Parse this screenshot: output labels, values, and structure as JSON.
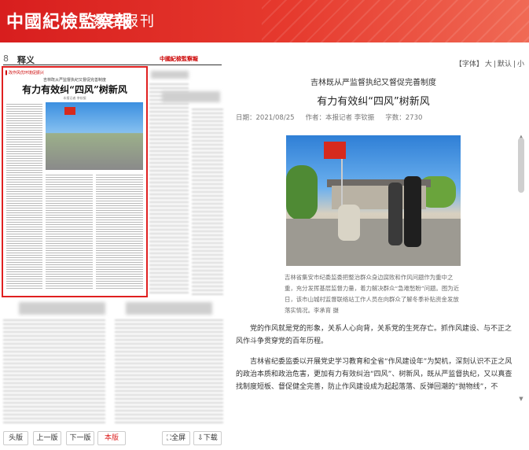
{
  "header": {
    "logo": "中國紀檢監察報",
    "subtitle": "数字报刊"
  },
  "page": {
    "number": "8",
    "column": "释义",
    "masthead": "中國紀檢監察報"
  },
  "thumb_article": {
    "tag": "▌改作风优环境促振兴",
    "kicker": "吉林既从严监督执纪又督促完善制度",
    "title": "有力有效纠“四风”树新风",
    "byline": "本报记者 李钦振"
  },
  "nav_buttons": [
    {
      "label": "头版"
    },
    {
      "label": "上一版"
    },
    {
      "label": "下一版"
    },
    {
      "label": "本版"
    },
    {
      "label": "全屏"
    },
    {
      "label": "下载"
    }
  ],
  "font_controls": {
    "label": "【字体】",
    "large": "大",
    "sep1": "|",
    "default": "默认",
    "sep2": "|",
    "small": "小"
  },
  "article": {
    "kicker": "吉林既从严监督执纪又督促完善制度",
    "title": "有力有效纠“四风”树新风",
    "date_label": "日期：",
    "date": "2021/08/25",
    "author_label": "作者：",
    "author": "本报记者 李钦振",
    "words_label": "字数：",
    "words": "2730",
    "caption": "吉林省集安市纪委监委把整治群众身边腐败和作风问题作为重中之重，充分发挥基层监督力量，着力解决群众“急难愁盼”问题。图为近日，该市山城村监督联络站工作人员在向群众了解冬季补贴资金发放落实情况。李承育 摄",
    "para1": "党的作风就是党的形象，关系人心向背，关系党的生死存亡。抓作风建设、与不正之风作斗争贯穿党的百年历程。",
    "para2": "吉林省纪委监委以开展党史学习教育和全省“作风建设年”为契机，深刻认识不正之风的政治本质和政治危害，更加有力有效纠治“四风”、树新风，既从严监督执纪，又以真查找制度短板、督促健全完善，防止作风建设成为起起落落、反弹回潮的“抛物线”，不"
  },
  "icons": {
    "fullscreen": "fullscreen-icon",
    "download": "download-icon",
    "scroll_up": "scroll-up-icon",
    "scroll_down": "scroll-down-icon"
  }
}
